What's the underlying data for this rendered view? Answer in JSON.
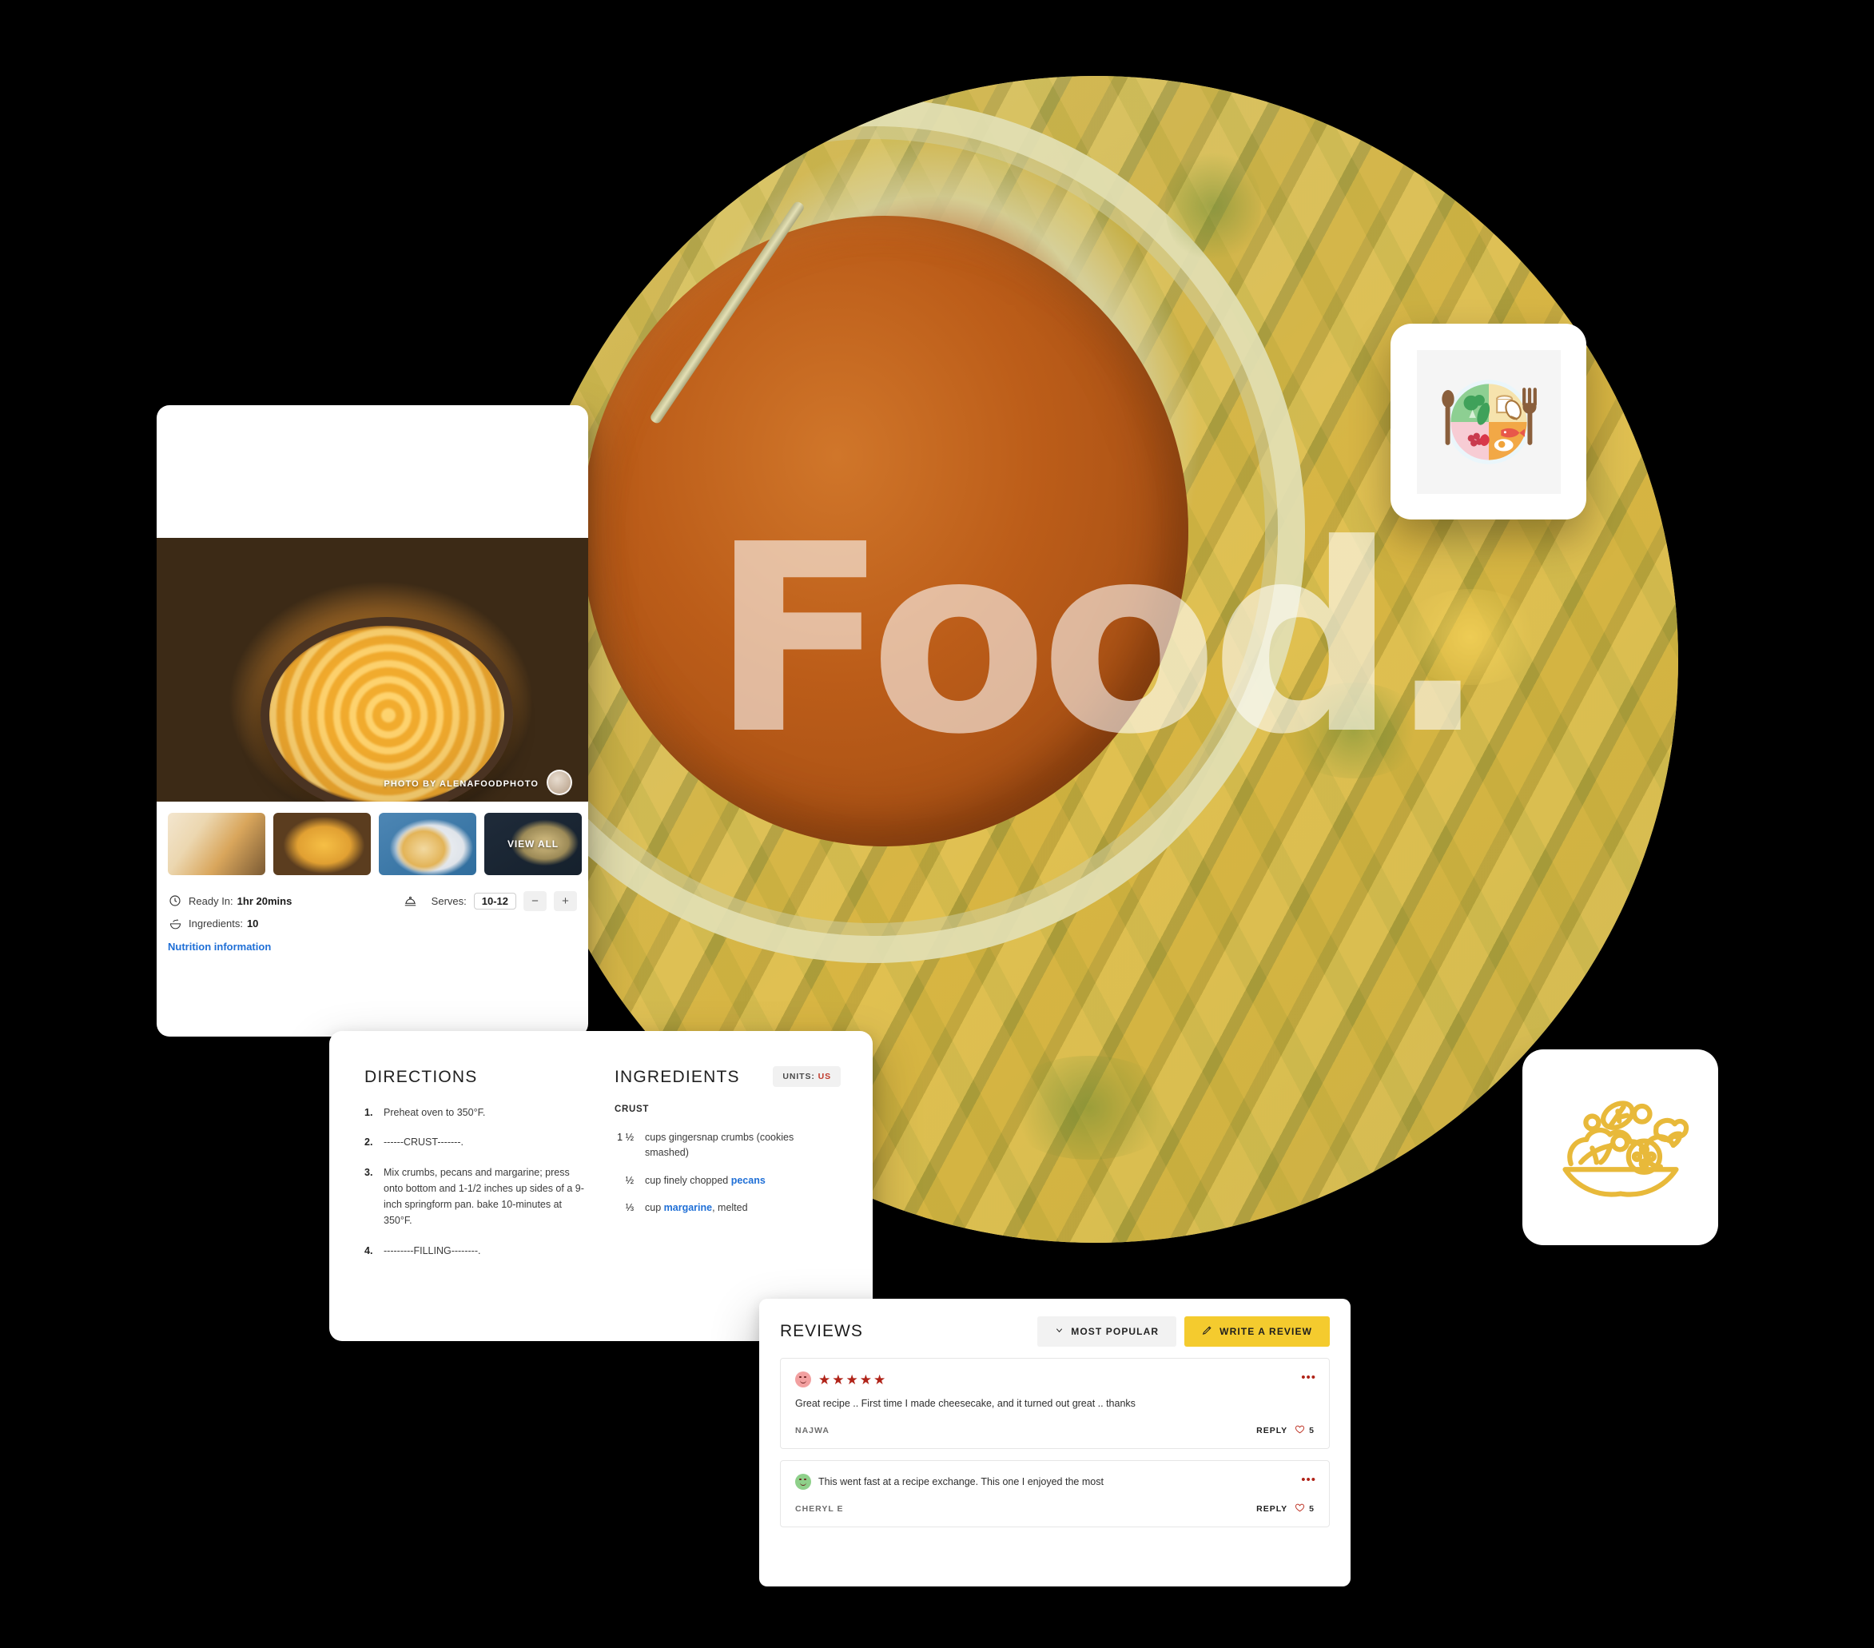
{
  "hero": {
    "watermark": "Food.",
    "alt": "tomato soup bowl with fried zucchini"
  },
  "recipe_card": {
    "photo_credit": "PHOTO BY ALENAFOODPHOTO",
    "thumbnails": [
      {
        "name": "thumb-swirl",
        "label": ""
      },
      {
        "name": "thumb-whole-cheesecake",
        "label": ""
      },
      {
        "name": "thumb-slice",
        "label": ""
      },
      {
        "name": "thumb-view-all",
        "label": "VIEW ALL"
      }
    ],
    "meta": {
      "ready_in_label": "Ready In:",
      "ready_in_value": "1hr 20mins",
      "ingredients_label": "Ingredients:",
      "ingredients_value": "10",
      "serves_label": "Serves:",
      "serves_value": "10-12",
      "decrement": "−",
      "increment": "+",
      "nutrition_link": "Nutrition information"
    },
    "icons": {
      "clock": "clock-icon",
      "bowl": "ingredients-bowl-icon",
      "serves": "serves-dish-icon"
    }
  },
  "directions_card": {
    "directions_title": "DIRECTIONS",
    "steps": [
      {
        "num": "1.",
        "text": "Preheat oven to 350°F."
      },
      {
        "num": "2.",
        "text": "------CRUST-------."
      },
      {
        "num": "3.",
        "text": "Mix crumbs, pecans and margarine; press onto bottom and 1-1/2 inches up sides of a 9-inch springform pan. bake 10-minutes at 350°F."
      },
      {
        "num": "4.",
        "text": "---------FILLING--------."
      }
    ],
    "ingredients_title": "INGREDIENTS",
    "units_label": "UNITS:",
    "units_value": "US",
    "ingredient_group": "CRUST",
    "ingredients": [
      {
        "qty": "1 ½",
        "pre": "cups gingersnap crumbs (cookies smashed)",
        "link": "",
        "post": ""
      },
      {
        "qty": "½",
        "pre": "cup finely chopped ",
        "link": "pecans",
        "post": ""
      },
      {
        "qty": "⅓",
        "pre": "cup ",
        "link": "margarine",
        "post": ", melted"
      }
    ]
  },
  "reviews_card": {
    "title": "REVIEWS",
    "sort_label": "MOST POPULAR",
    "write_label": "WRITE A REVIEW",
    "sort_icon": "chevron-down-icon",
    "write_icon": "pencil-icon",
    "reviews": [
      {
        "avatar_color": "#f2a0a0",
        "stars": 5,
        "star_glyph": "★",
        "text": "Great recipe .. First time I made cheesecake, and it turned out great .. thanks",
        "author": "NAJWA",
        "reply_label": "REPLY",
        "likes": "5",
        "menu": "•••"
      },
      {
        "avatar_color": "#8ed08a",
        "stars": 0,
        "star_glyph": "★",
        "text": "This went fast at a recipe exchange. This one I enjoyed the most",
        "author": "CHERYL E",
        "reply_label": "REPLY",
        "likes": "5",
        "menu": "•••"
      }
    ]
  },
  "floating_icons": {
    "plate": {
      "name": "balanced-plate-icon",
      "alt": "plate with vegetables grains protein fruit, spoon and fork"
    },
    "salad": {
      "name": "salad-bowl-icon",
      "alt": "yellow outline salad bowl with vegetables"
    }
  },
  "colors": {
    "accent_yellow": "#f4cb2e",
    "link_blue": "#1f6fd6",
    "star_red": "#b02318",
    "units_red": "#c0392b",
    "salad_icon": "#e8b93a"
  }
}
